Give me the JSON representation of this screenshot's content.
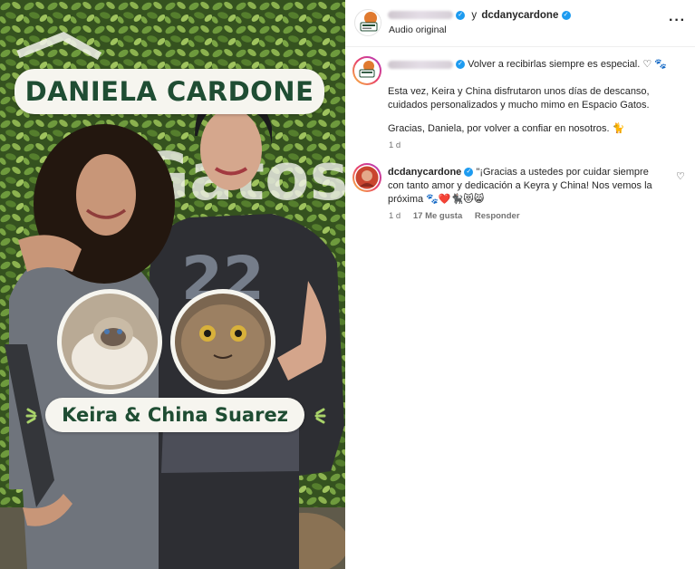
{
  "post": {
    "title_banner": "DANIELA CARDONE",
    "name_banner": "Keira & China Suarez"
  },
  "header": {
    "separator": "y",
    "coauthor": "dcdanycardone",
    "audio": "Audio original",
    "more_icon": "more-horizontal-icon"
  },
  "caption": {
    "line1": "Volver a recibirlas siempre es especial. ♡ 🐾",
    "para1": "Esta vez, Keira y China disfrutaron unos días de descanso, cuidados personalizados y mucho mimo en Espacio Gatos.",
    "para2": "Gracias, Daniela, por volver a confiar en nosotros. 🐈",
    "time": "1 d"
  },
  "reply": {
    "username": "dcdanycardone",
    "text": "\"¡Gracias a ustedes por cuidar siempre con tanto amor y dedicación a Keyra y China! Nos vemos la próxima 🐾❤️🐈‍⬛😻😸",
    "time": "1 d",
    "likes": "17 Me gusta",
    "reply_label": "Responder"
  },
  "colors": {
    "verified": "#1d9bf0",
    "banner_text": "#1f4d33",
    "banner_bg": "#f6f5ef",
    "meta": "#737373"
  }
}
